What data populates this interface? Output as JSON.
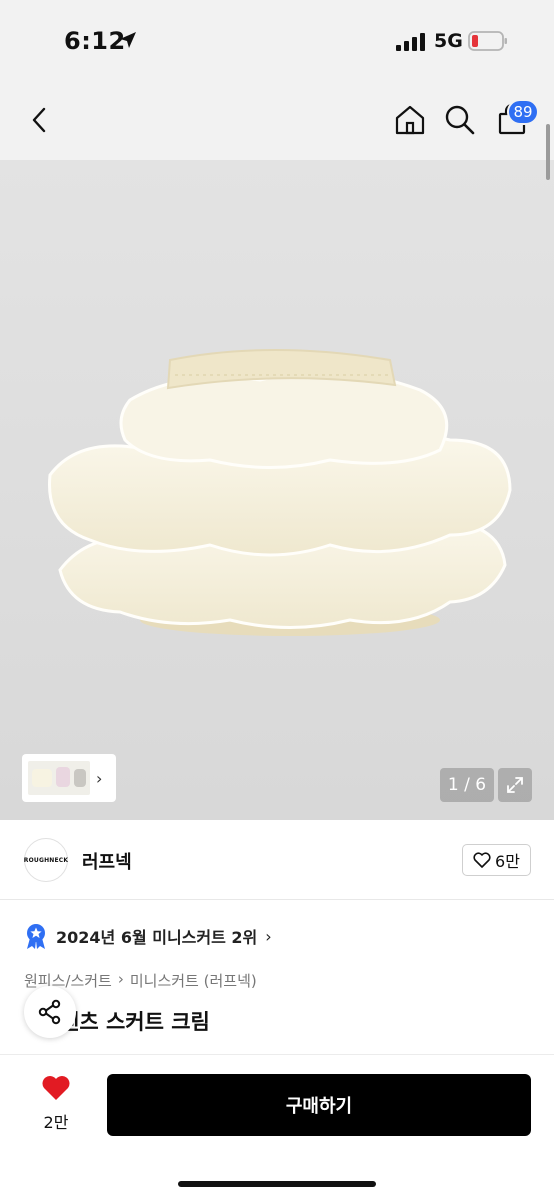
{
  "status": {
    "time": "6:12",
    "network": "5G"
  },
  "nav": {
    "cart_count": "89"
  },
  "gallery": {
    "page_indicator": "1 / 6",
    "thumb_arrow": "›"
  },
  "brand": {
    "logo_text": "ROUGHNECK",
    "name": "러프넥",
    "likes": "6만"
  },
  "rank": {
    "text": "2024년 6월 미니스커트 2위",
    "arrow": "›"
  },
  "breadcrumb": {
    "category": "원피스/스커트",
    "separator": "›",
    "subcategory": "미니스커트 (러프넥)"
  },
  "product": {
    "name": "팬츠 스커트 크림"
  },
  "bottom": {
    "wish_count": "2만",
    "buy_label": "구매하기"
  },
  "colors": {
    "cart_badge": "#2f6ff3",
    "rank_badge": "#2f6ff3",
    "wish_heart": "#e21b23",
    "buy_button": "#000000"
  }
}
